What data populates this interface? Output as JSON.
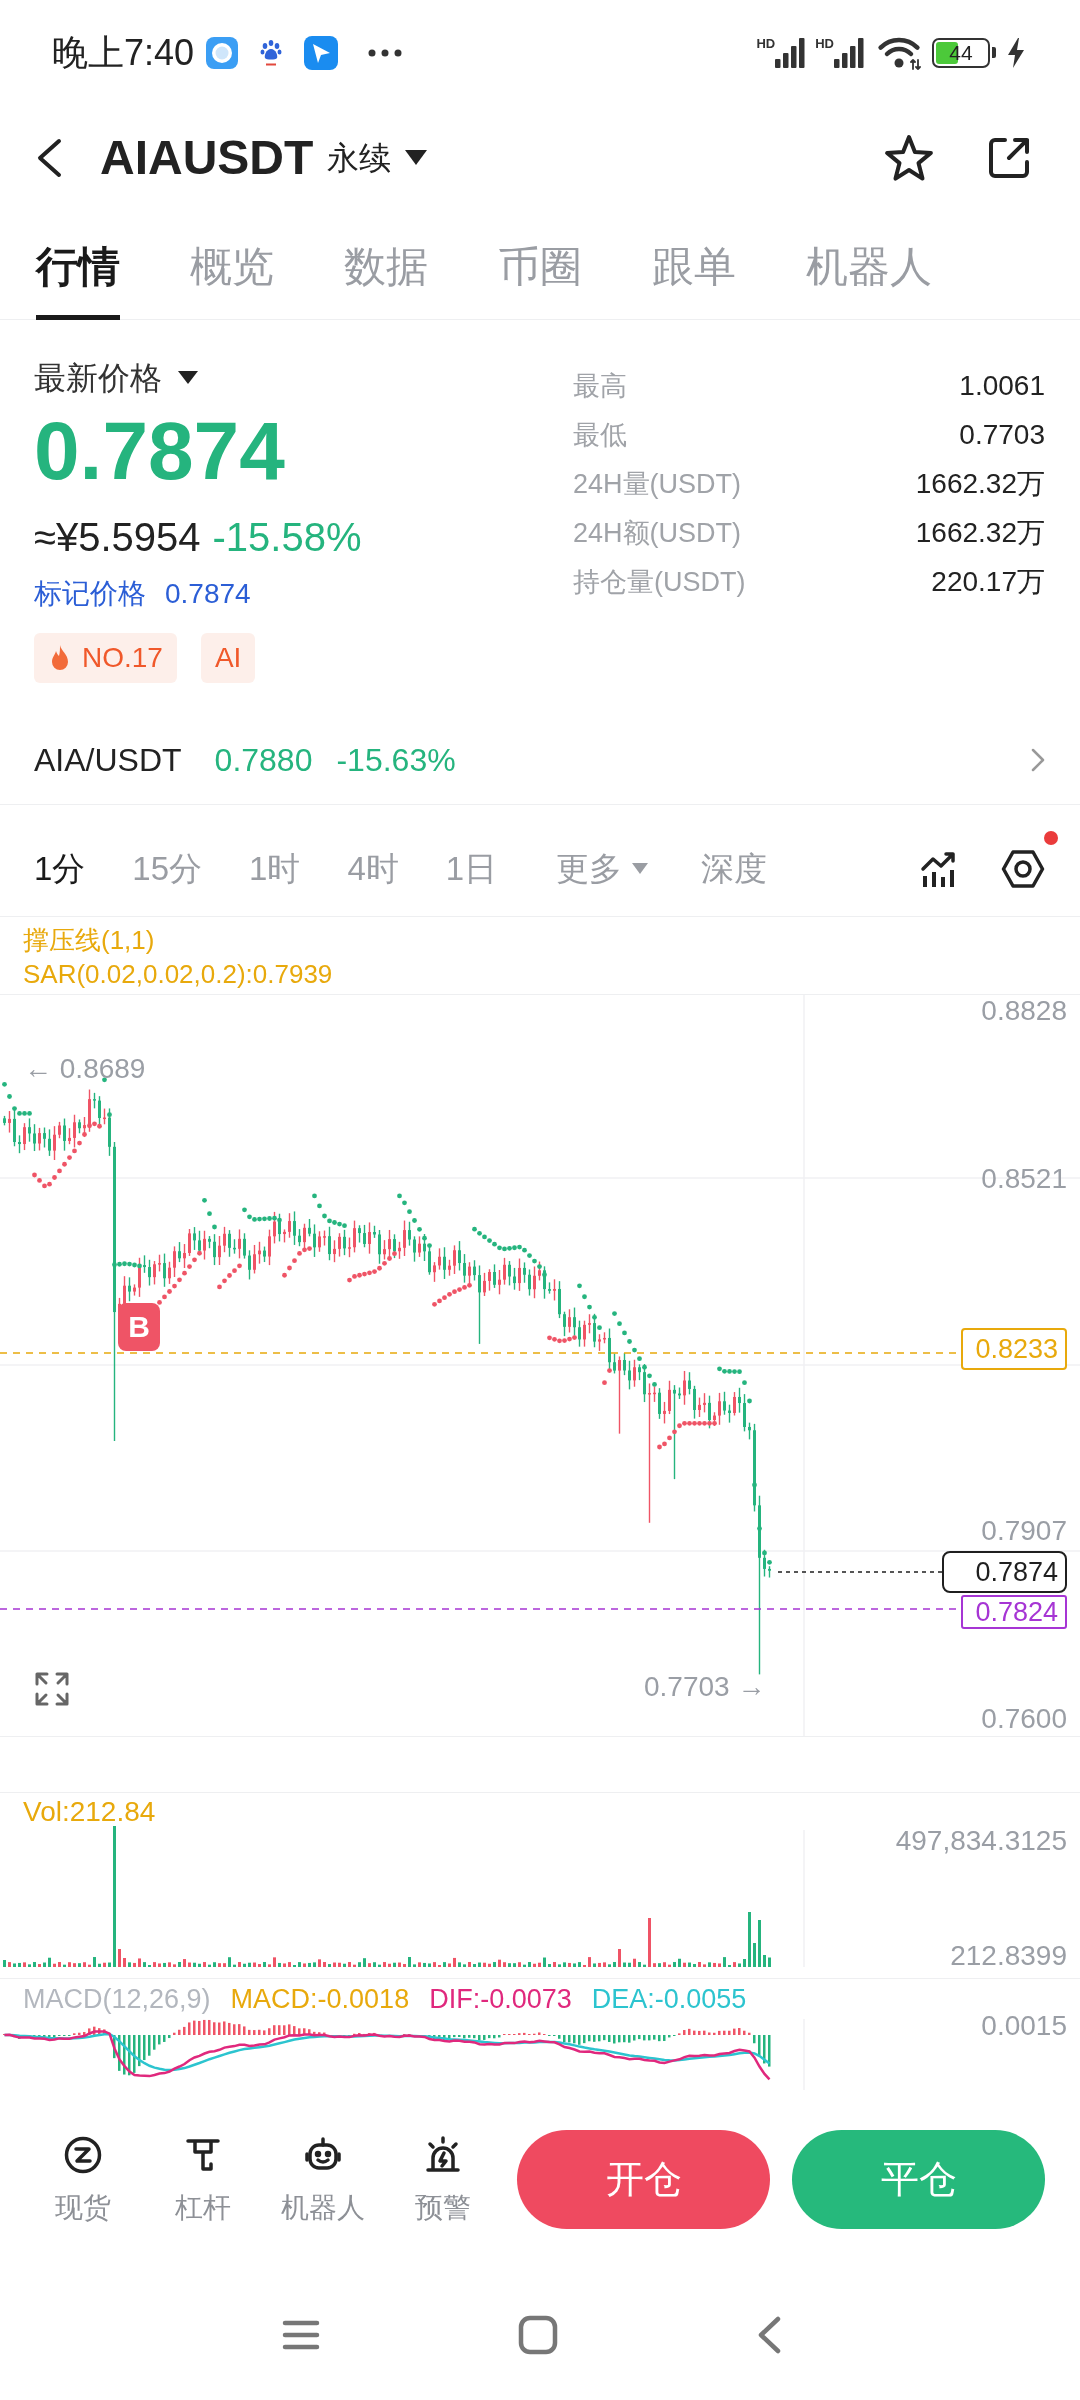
{
  "status_bar": {
    "time": "晚上7:40",
    "signals": [
      {
        "label": "HD"
      },
      {
        "label": "HD"
      }
    ],
    "battery": {
      "level": 0.44,
      "reading": "44",
      "charging": true
    }
  },
  "header": {
    "title": "AIAUSDT",
    "contract_type": "永续",
    "favorite": false
  },
  "tabs": [
    {
      "label": "行情",
      "selected": true
    },
    {
      "label": "概览",
      "selected": false
    },
    {
      "label": "数据",
      "selected": false
    },
    {
      "label": "币圈",
      "selected": false
    },
    {
      "label": "跟单",
      "selected": false
    },
    {
      "label": "机器人",
      "selected": false
    }
  ],
  "price": {
    "label": "最新价格",
    "last": "0.7874",
    "cny": "≈¥5.5954",
    "change": "-15.58%",
    "mark_label": "标记价格",
    "mark_value": "0.7874",
    "tags": [
      {
        "kind": "rank",
        "label": "NO.17"
      },
      {
        "kind": "sector",
        "label": "AI"
      }
    ]
  },
  "stats": [
    {
      "label": "最高",
      "value": "1.0061"
    },
    {
      "label": "最低",
      "value": "0.7703"
    },
    {
      "label": "24H量(USDT)",
      "value": "1662.32万"
    },
    {
      "label": "24H额(USDT)",
      "value": "1662.32万"
    },
    {
      "label": "持仓量(USDT)",
      "value": "220.17万"
    }
  ],
  "spot": {
    "pair": "AIA/USDT",
    "price": "0.7880",
    "change": "-15.63%"
  },
  "chart_toolbar": {
    "intervals": [
      {
        "label": "1分",
        "kind": "interval",
        "selected": true
      },
      {
        "label": "15分",
        "kind": "interval",
        "selected": false
      },
      {
        "label": "1时",
        "kind": "interval",
        "selected": false
      },
      {
        "label": "4时",
        "kind": "interval",
        "selected": false
      },
      {
        "label": "1日",
        "kind": "interval",
        "selected": false
      },
      {
        "label": "更多",
        "kind": "menu",
        "selected": false
      },
      {
        "label": "深度",
        "kind": "view",
        "selected": false
      }
    ],
    "settings_alert": true
  },
  "indicators": [
    "撑压线(1,1)",
    "SAR(0.02,0.02,0.2):0.7939"
  ],
  "price_chart": {
    "axis_labels": [
      "0.8828",
      "0.8521",
      "0.7907",
      "0.7600"
    ],
    "high_label": "← 0.8689",
    "low_label": "0.7703 →",
    "trade_marker": "B",
    "price_tags": [
      {
        "kind": "alert",
        "value": "0.8233",
        "color": "#e8a90c"
      },
      {
        "kind": "last",
        "value": "0.7874",
        "color": "#1f1f1f"
      },
      {
        "kind": "order",
        "value": "0.7824",
        "color": "#a635d4"
      }
    ]
  },
  "volume": {
    "label": "Vol:212.84",
    "axis_labels": [
      "497,834.3125",
      "212.8399"
    ]
  },
  "macd": {
    "items": [
      {
        "text": "MACD(12,26,9)",
        "color": "#b3b7be"
      },
      {
        "text": "MACD:-0.0018",
        "color": "#e8a90c"
      },
      {
        "text": "DIF:-0.0073",
        "color": "#e0287d"
      },
      {
        "text": "DEA:-0.0055",
        "color": "#2cc4cf"
      }
    ],
    "axis_label": "0.0015"
  },
  "bottom_bar": {
    "shortcuts": [
      {
        "kind": "spot",
        "label": "现货"
      },
      {
        "kind": "margin",
        "label": "杠杆"
      },
      {
        "kind": "bot",
        "label": "机器人"
      },
      {
        "kind": "alert",
        "label": "预警"
      }
    ],
    "buttons": [
      {
        "kind": "open",
        "label": "开仓"
      },
      {
        "kind": "close",
        "label": "平仓"
      }
    ]
  }
}
